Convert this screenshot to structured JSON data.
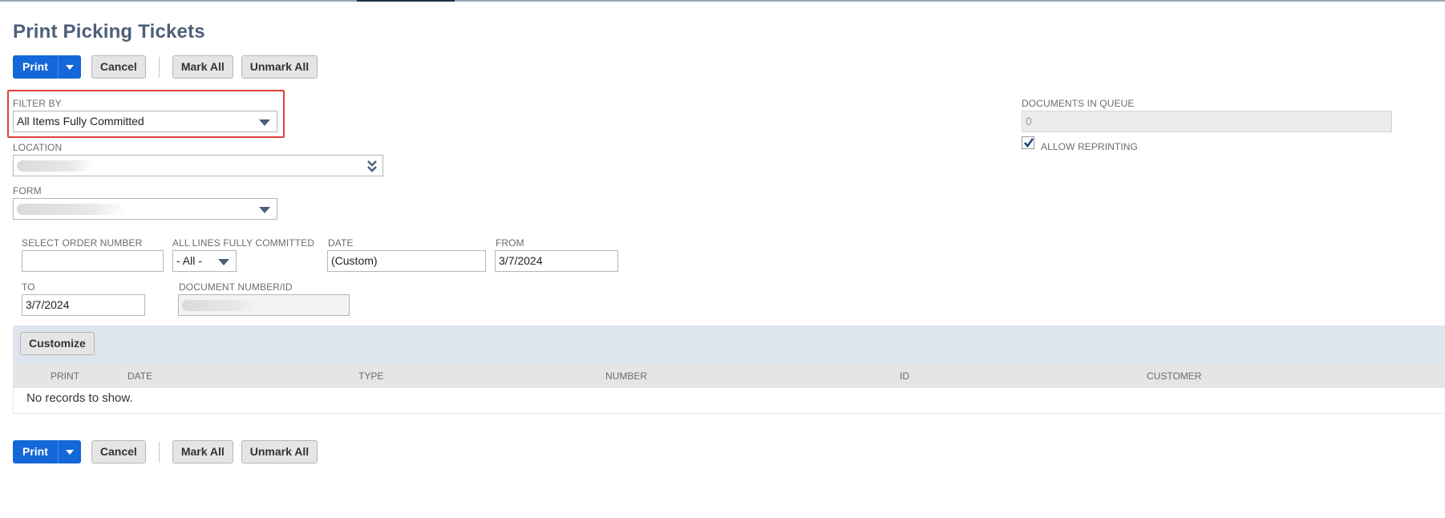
{
  "page": {
    "title": "Print Picking Tickets"
  },
  "toolbar": {
    "print_label": "Print",
    "cancel_label": "Cancel",
    "mark_all_label": "Mark All",
    "unmark_all_label": "Unmark All"
  },
  "filters": {
    "filter_by": {
      "label": "FILTER BY",
      "value": "All Items Fully Committed"
    },
    "location": {
      "label": "LOCATION",
      "value": ""
    },
    "form": {
      "label": "FORM",
      "value": ""
    },
    "documents_in_queue": {
      "label": "DOCUMENTS IN QUEUE",
      "value": "0"
    },
    "allow_reprinting": {
      "label": "ALLOW REPRINTING",
      "checked": true
    },
    "select_order_number": {
      "label": "SELECT ORDER NUMBER",
      "value": ""
    },
    "all_lines_fully_committed": {
      "label": "ALL LINES FULLY COMMITTED",
      "value": "- All -"
    },
    "date": {
      "label": "DATE",
      "value": "(Custom)"
    },
    "from": {
      "label": "FROM",
      "value": "3/7/2024"
    },
    "to": {
      "label": "TO",
      "value": "3/7/2024"
    },
    "document_number": {
      "label": "DOCUMENT NUMBER/ID",
      "value": ""
    }
  },
  "list": {
    "customize_label": "Customize",
    "columns": [
      "PRINT",
      "DATE",
      "TYPE",
      "NUMBER",
      "ID",
      "CUSTOMER"
    ],
    "empty_text": "No records to show."
  },
  "colors": {
    "primary_button": "#1467d8",
    "title": "#4d5f79",
    "highlight": "#e0413a",
    "band": "#dfe5ee"
  },
  "icons": {
    "print_dropdown": "caret-down-icon",
    "select_dropdown": "caret-down-icon",
    "location_dropdown": "double-chevron-down-icon",
    "checkbox_mark": "checkmark-icon"
  }
}
